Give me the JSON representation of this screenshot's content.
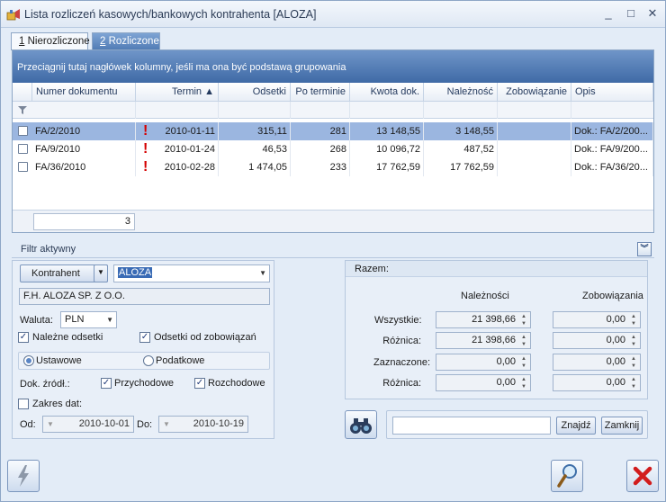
{
  "window": {
    "title": "Lista rozliczeń kasowych/bankowych kontrahenta [ALOZA]",
    "controls": {
      "minimize": "_",
      "maximize": "□",
      "close": "✕"
    }
  },
  "tabs": [
    {
      "hotkey": "1",
      "label": " Nierozliczone"
    },
    {
      "hotkey": "2",
      "label": " Rozliczone"
    }
  ],
  "grid": {
    "group_hint": "Przeciągnij tutaj nagłówek kolumny, jeśli ma ona być podstawą grupowania",
    "columns": [
      "Numer dokumentu",
      "Termin ▲",
      "Odsetki",
      "Po terminie",
      "Kwota dok.",
      "Należność",
      "Zobowiązanie",
      "Opis"
    ],
    "rows": [
      {
        "number": "FA/2/2010",
        "overdue_mark": "!",
        "term": "2010-01-11",
        "interest": "315,11",
        "days_overdue": "281",
        "amount": "13 148,55",
        "receivable": "3 148,55",
        "liability": "",
        "description": "Dok.: FA/2/200..."
      },
      {
        "number": "FA/9/2010",
        "overdue_mark": "!",
        "term": "2010-01-24",
        "interest": "46,53",
        "days_overdue": "268",
        "amount": "10 096,72",
        "receivable": "487,52",
        "liability": "",
        "description": "Dok.: FA/9/200..."
      },
      {
        "number": "FA/36/2010",
        "overdue_mark": "!",
        "term": "2010-02-28",
        "interest": "1 474,05",
        "days_overdue": "233",
        "amount": "17 762,59",
        "receivable": "17 762,59",
        "liability": "",
        "description": "Dok.: FA/36/20..."
      }
    ],
    "count": "3"
  },
  "filter": {
    "header": "Filtr aktywny",
    "kontrahent_button": "Kontrahent",
    "kontrahent_code": "ALOZA",
    "kontrahent_name": "F.H. ALOZA SP. Z O.O.",
    "waluta_label": "Waluta:",
    "waluta_value": "PLN",
    "nalezne_odsetki": "Należne odsetki",
    "odsetki_zobowiazan": "Odsetki od zobowiązań",
    "ustawowe": "Ustawowe",
    "podatkowe": "Podatkowe",
    "dok_zrodl": "Dok. źródł.:",
    "przychodowe": "Przychodowe",
    "rozchodowe": "Rozchodowe",
    "zakres_dat": "Zakres dat:",
    "od_label": "Od:",
    "od_value": "2010-10-01",
    "do_label": "Do:",
    "do_value": "2010-10-19"
  },
  "summary": {
    "header": "Razem:",
    "col_receivables": "Należności",
    "col_liabilities": "Zobowiązania",
    "rows": [
      {
        "label": "Wszystkie:",
        "receivable": "21 398,66",
        "liability": "0,00"
      },
      {
        "label": "Różnica:",
        "receivable": "21 398,66",
        "liability": "0,00"
      },
      {
        "label": "Zaznaczone:",
        "receivable": "0,00",
        "liability": "0,00"
      },
      {
        "label": "Różnica:",
        "receivable": "0,00",
        "liability": "0,00"
      }
    ]
  },
  "search": {
    "value": "",
    "find_button": "Znajdź",
    "close_button": "Zamknij"
  },
  "colors": {
    "selected_row": "#9bb6e0",
    "group_bar": "#4f7ab4",
    "overdue": "#d40000"
  }
}
